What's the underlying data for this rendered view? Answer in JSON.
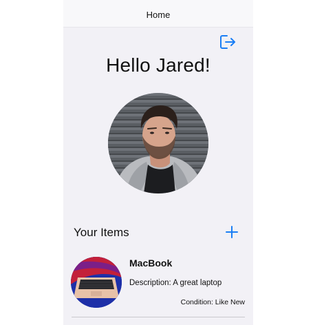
{
  "nav": {
    "title": "Home"
  },
  "header": {
    "greeting": "Hello Jared!",
    "logout_icon": "logout-icon"
  },
  "profile": {
    "avatar_icon": "profile-photo"
  },
  "items_section": {
    "title": "Your Items",
    "add_icon": "plus-icon",
    "items": [
      {
        "name": "MacBook",
        "description": "Description: A great laptop",
        "condition": "Condition: Like New"
      }
    ]
  },
  "colors": {
    "accent": "#1a7ef5",
    "background": "#f2f1f6",
    "nav_background": "#f8f8fa",
    "text": "#111111"
  }
}
